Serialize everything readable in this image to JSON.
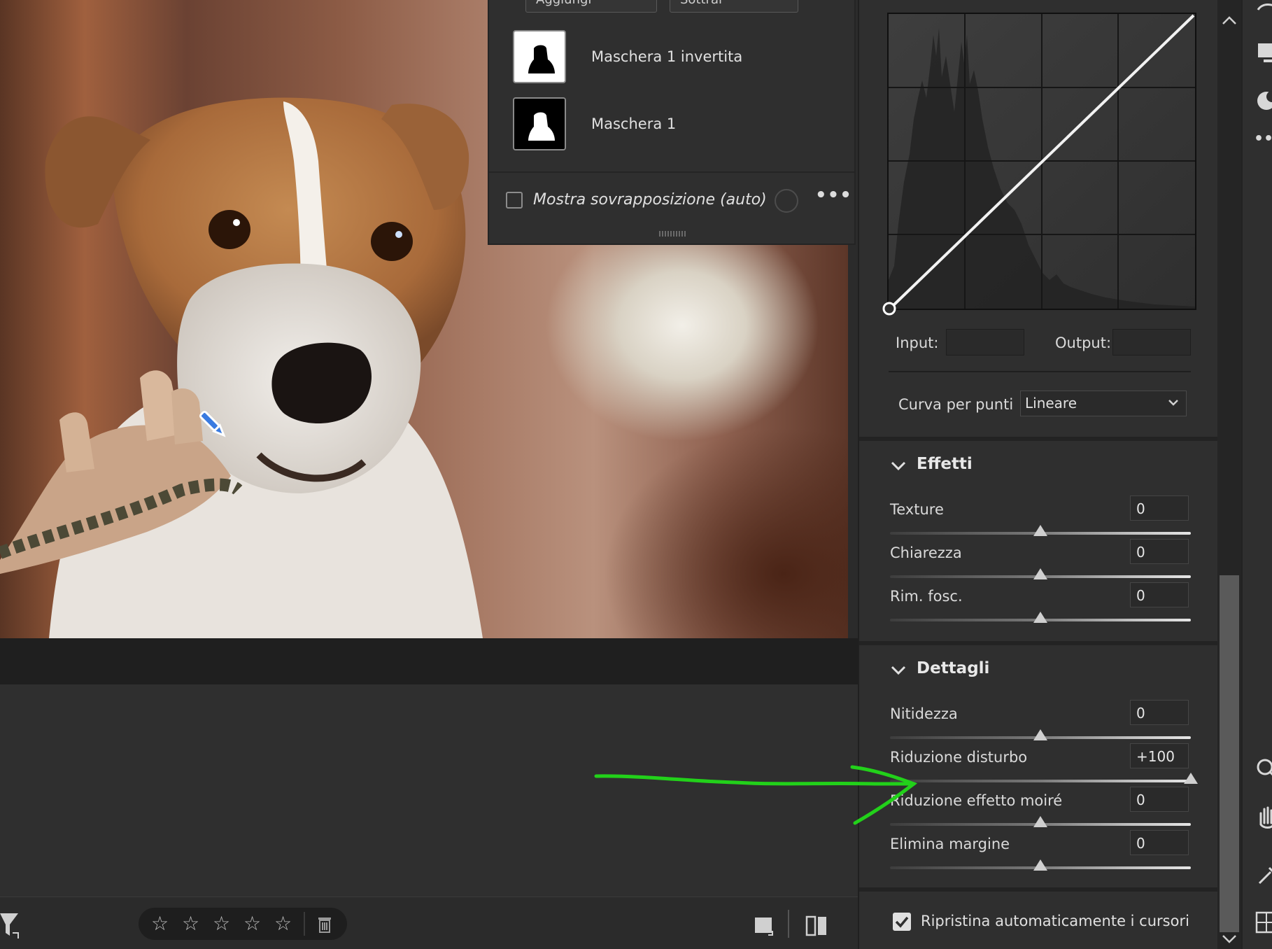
{
  "mask_panel": {
    "top_buttons": [
      "Aggiungi",
      "Sottrai"
    ],
    "masks": [
      {
        "label": "Maschera 1 invertita"
      },
      {
        "label": "Maschera 1"
      }
    ],
    "overlay_label": "Mostra sovrapposizione (auto)"
  },
  "curve": {
    "input_label": "Input:",
    "output_label": "Output:",
    "point_curve_label": "Curva per punti",
    "point_curve_value": "Lineare"
  },
  "effects": {
    "title": "Effetti",
    "sliders": [
      {
        "label": "Texture",
        "value": "0",
        "position": 0.5
      },
      {
        "label": "Chiarezza",
        "value": "0",
        "position": 0.5
      },
      {
        "label": "Rim. fosc.",
        "value": "0",
        "position": 0.5
      }
    ]
  },
  "details": {
    "title": "Dettagli",
    "sliders": [
      {
        "label": "Nitidezza",
        "value": "0",
        "position": 0.5
      },
      {
        "label": "Riduzione disturbo",
        "value": "+100",
        "position": 1.0
      },
      {
        "label": "Riduzione effetto moiré",
        "value": "0",
        "position": 0.5
      },
      {
        "label": "Elimina margine",
        "value": "0",
        "position": 0.5
      }
    ]
  },
  "reset_label": "Ripristina automaticamente i cursori",
  "rating": {
    "stars": [
      "☆",
      "☆",
      "☆",
      "☆",
      "☆"
    ]
  },
  "icons": {
    "brush": "brush-icon",
    "filter": "filter-icon",
    "trash": "trash-icon",
    "zoom": "zoom-icon",
    "hand": "hand-icon"
  },
  "colors": {
    "annotation": "#22d11a",
    "brush_cursor": "#3a7be0"
  }
}
